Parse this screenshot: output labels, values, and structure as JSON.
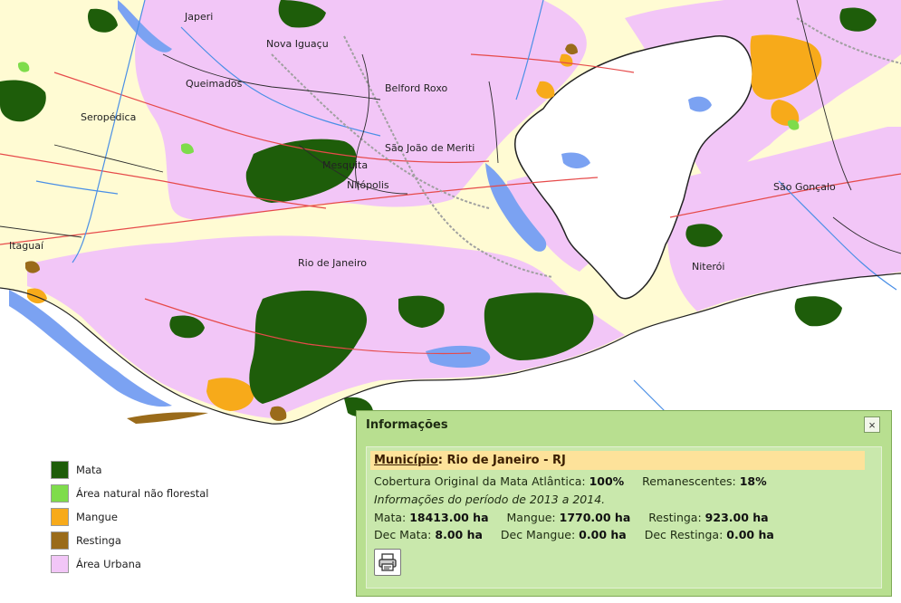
{
  "map": {
    "colors": {
      "background": "#fffbd3",
      "mata": "#1e5d0a",
      "area_natural": "#7edc4b",
      "mangue": "#f7aa1a",
      "restinga": "#9a6b1a",
      "area_urbana": "#f2c6f7",
      "water": "#7ba2f2",
      "bay": "#ffffff",
      "roads": "#e64a4a",
      "rivers": "#4a8fe6",
      "boundaries": "#2b2b2b",
      "rail": "#a0a0a0"
    },
    "cities": [
      "Japeri",
      "Nova Iguaçu",
      "Queimados",
      "Belford Roxo",
      "Seropédica",
      "São João de Meriti",
      "Mesquita",
      "Nilópolis",
      "São Gonçalo",
      "Itaguaí",
      "Rio de Janeiro",
      "Niterói"
    ]
  },
  "legend": {
    "items": [
      {
        "label": "Mata",
        "color": "#1e5d0a"
      },
      {
        "label": "Área natural não florestal",
        "color": "#7edc4b"
      },
      {
        "label": "Mangue",
        "color": "#f7aa1a"
      },
      {
        "label": "Restinga",
        "color": "#9a6b1a"
      },
      {
        "label": "Área Urbana",
        "color": "#f2c6f7"
      }
    ]
  },
  "panel": {
    "title": "Informações",
    "close_icon": "×",
    "municipio_key": "Município",
    "municipio_value": ": Rio de Janeiro - RJ",
    "cobertura_label": "Cobertura Original da Mata Atlântica:",
    "cobertura_value": "100%",
    "remanescentes_label": "Remanescentes:",
    "remanescentes_value": "18%",
    "periodo": "Informações do período de 2013 a 2014.",
    "mata_label": "Mata:",
    "mata_value": "18413.00 ha",
    "mangue_label": "Mangue:",
    "mangue_value": "1770.00 ha",
    "restinga_label": "Restinga:",
    "restinga_value": "923.00 ha",
    "dec_mata_label": "Dec Mata:",
    "dec_mata_value": "8.00 ha",
    "dec_mangue_label": "Dec Mangue:",
    "dec_mangue_value": "0.00 ha",
    "dec_restinga_label": "Dec Restinga:",
    "dec_restinga_value": "0.00 ha",
    "print_icon": "printer-icon"
  }
}
